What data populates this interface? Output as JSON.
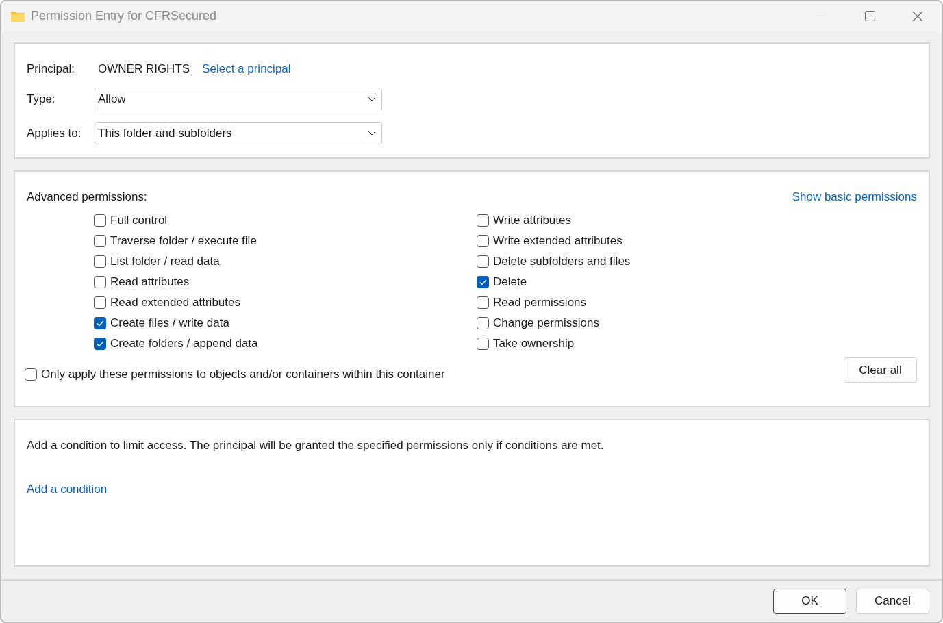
{
  "window": {
    "title": "Permission Entry for CFRSecured"
  },
  "principal": {
    "label": "Principal:",
    "value": "OWNER RIGHTS",
    "link": "Select a principal"
  },
  "type": {
    "label": "Type:",
    "value": "Allow"
  },
  "applies_to": {
    "label": "Applies to:",
    "value": "This folder and subfolders"
  },
  "permissions": {
    "heading": "Advanced permissions:",
    "toggle_link": "Show basic permissions",
    "columns": [
      [
        {
          "label": "Full control",
          "checked": false
        },
        {
          "label": "Traverse folder / execute file",
          "checked": false
        },
        {
          "label": "List folder / read data",
          "checked": false
        },
        {
          "label": "Read attributes",
          "checked": false
        },
        {
          "label": "Read extended attributes",
          "checked": false
        },
        {
          "label": "Create files / write data",
          "checked": true
        },
        {
          "label": "Create folders / append data",
          "checked": true
        }
      ],
      [
        {
          "label": "Write attributes",
          "checked": false
        },
        {
          "label": "Write extended attributes",
          "checked": false
        },
        {
          "label": "Delete subfolders and files",
          "checked": false
        },
        {
          "label": "Delete",
          "checked": true
        },
        {
          "label": "Read permissions",
          "checked": false
        },
        {
          "label": "Change permissions",
          "checked": false
        },
        {
          "label": "Take ownership",
          "checked": false
        }
      ]
    ],
    "only_apply": {
      "label": "Only apply these permissions to objects and/or containers within this container",
      "checked": false
    },
    "clear_button": "Clear all"
  },
  "condition": {
    "text": "Add a condition to limit access. The principal will be granted the specified permissions only if conditions are met.",
    "link": "Add a condition"
  },
  "buttons": [
    "OK",
    "Cancel"
  ]
}
